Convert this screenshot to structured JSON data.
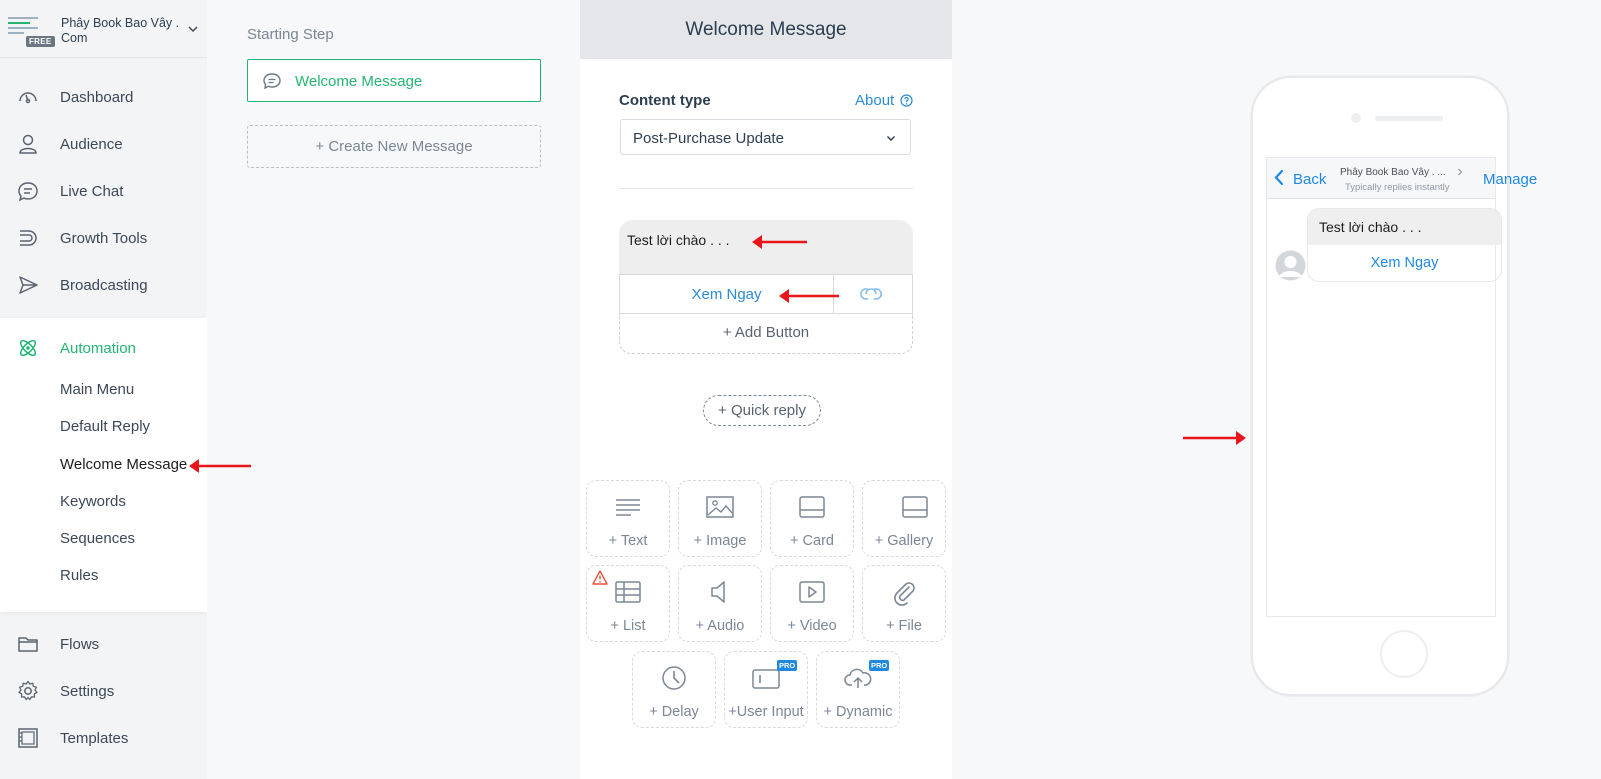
{
  "sidebar": {
    "brand": {
      "name": "Phây Book Bao Vây . Com",
      "badge": "FREE"
    },
    "nav_top": [
      {
        "label": "Dashboard",
        "icon": "dashboard-icon"
      },
      {
        "label": "Audience",
        "icon": "user-icon"
      },
      {
        "label": "Live Chat",
        "icon": "chat-icon"
      },
      {
        "label": "Growth Tools",
        "icon": "magnet-icon"
      },
      {
        "label": "Broadcasting",
        "icon": "send-icon"
      }
    ],
    "automation": {
      "label": "Automation",
      "icon": "atom-icon",
      "items": [
        "Main Menu",
        "Default Reply",
        "Welcome Message",
        "Keywords",
        "Sequences",
        "Rules"
      ],
      "active": "Welcome Message"
    },
    "nav_bottom": [
      {
        "label": "Flows",
        "icon": "folder-icon"
      },
      {
        "label": "Settings",
        "icon": "gear-icon"
      },
      {
        "label": "Templates",
        "icon": "templates-icon"
      }
    ]
  },
  "steps": {
    "title": "Starting Step",
    "card_label": "Welcome Message",
    "create_label": "+ Create New Message"
  },
  "editor": {
    "title": "Welcome Message",
    "content_type_label": "Content type",
    "about_label": "About",
    "content_type_value": "Post-Purchase Update",
    "message_text": "Test lời chào . . .",
    "button_label": "Xem Ngay",
    "add_button_label": "+ Add Button",
    "quick_reply_label": "+ Quick reply",
    "tiles": [
      {
        "label": "+ Text",
        "icon": "text-icon"
      },
      {
        "label": "+ Image",
        "icon": "image-icon"
      },
      {
        "label": "+ Card",
        "icon": "card-icon"
      },
      {
        "label": "+ Gallery",
        "icon": "gallery-icon"
      },
      {
        "label": "+ List",
        "icon": "list-icon"
      },
      {
        "label": "+ Audio",
        "icon": "audio-icon"
      },
      {
        "label": "+ Video",
        "icon": "video-icon"
      },
      {
        "label": "+ File",
        "icon": "paperclip-icon"
      },
      {
        "label": "+ Delay",
        "icon": "clock-icon"
      },
      {
        "label": "+User Input",
        "icon": "user-input-icon",
        "badge": "PRO"
      },
      {
        "label": "+ Dynamic",
        "icon": "cloud-upload-icon",
        "badge": "PRO"
      }
    ]
  },
  "preview": {
    "back_label": "Back",
    "page_name": "Phây Book Bao Vây . ...",
    "subtitle": "Typically replies instantly",
    "manage_label": "Manage",
    "message_text": "Test lời chào . . .",
    "button_label": "Xem Ngay"
  },
  "colors": {
    "accent_green": "#22b573",
    "link_blue": "#2a8ad7",
    "annotation_red": "#e8161b"
  }
}
